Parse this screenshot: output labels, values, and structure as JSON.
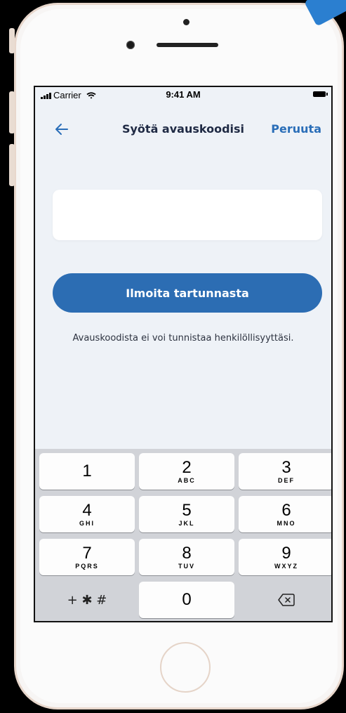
{
  "status_bar": {
    "carrier": "Carrier",
    "time": "9:41 AM"
  },
  "nav": {
    "title": "Syötä avauskoodisi",
    "cancel": "Peruuta"
  },
  "code_input": {
    "value": "",
    "placeholder": ""
  },
  "report_button": {
    "label": "Ilmoita tartunnasta"
  },
  "info_text": "Avauskoodista ei voi tunnistaa henkilöllisyyttäsi.",
  "keypad": {
    "keys": [
      {
        "num": "1",
        "letters": ""
      },
      {
        "num": "2",
        "letters": "ABC"
      },
      {
        "num": "3",
        "letters": "DEF"
      },
      {
        "num": "4",
        "letters": "GHI"
      },
      {
        "num": "5",
        "letters": "JKL"
      },
      {
        "num": "6",
        "letters": "MNO"
      },
      {
        "num": "7",
        "letters": "PQRS"
      },
      {
        "num": "8",
        "letters": "TUV"
      },
      {
        "num": "9",
        "letters": "WXYZ"
      }
    ],
    "symbols": "+ ✱ #",
    "zero": "0"
  },
  "colors": {
    "accent": "#2c6db3",
    "link": "#2a6eb8",
    "keypad_bg": "#d1d3d8",
    "screen_bg": "#eef2f7"
  },
  "icons": [
    "signal-icon",
    "wifi-icon",
    "battery-icon",
    "back-arrow-icon",
    "backspace-icon"
  ]
}
